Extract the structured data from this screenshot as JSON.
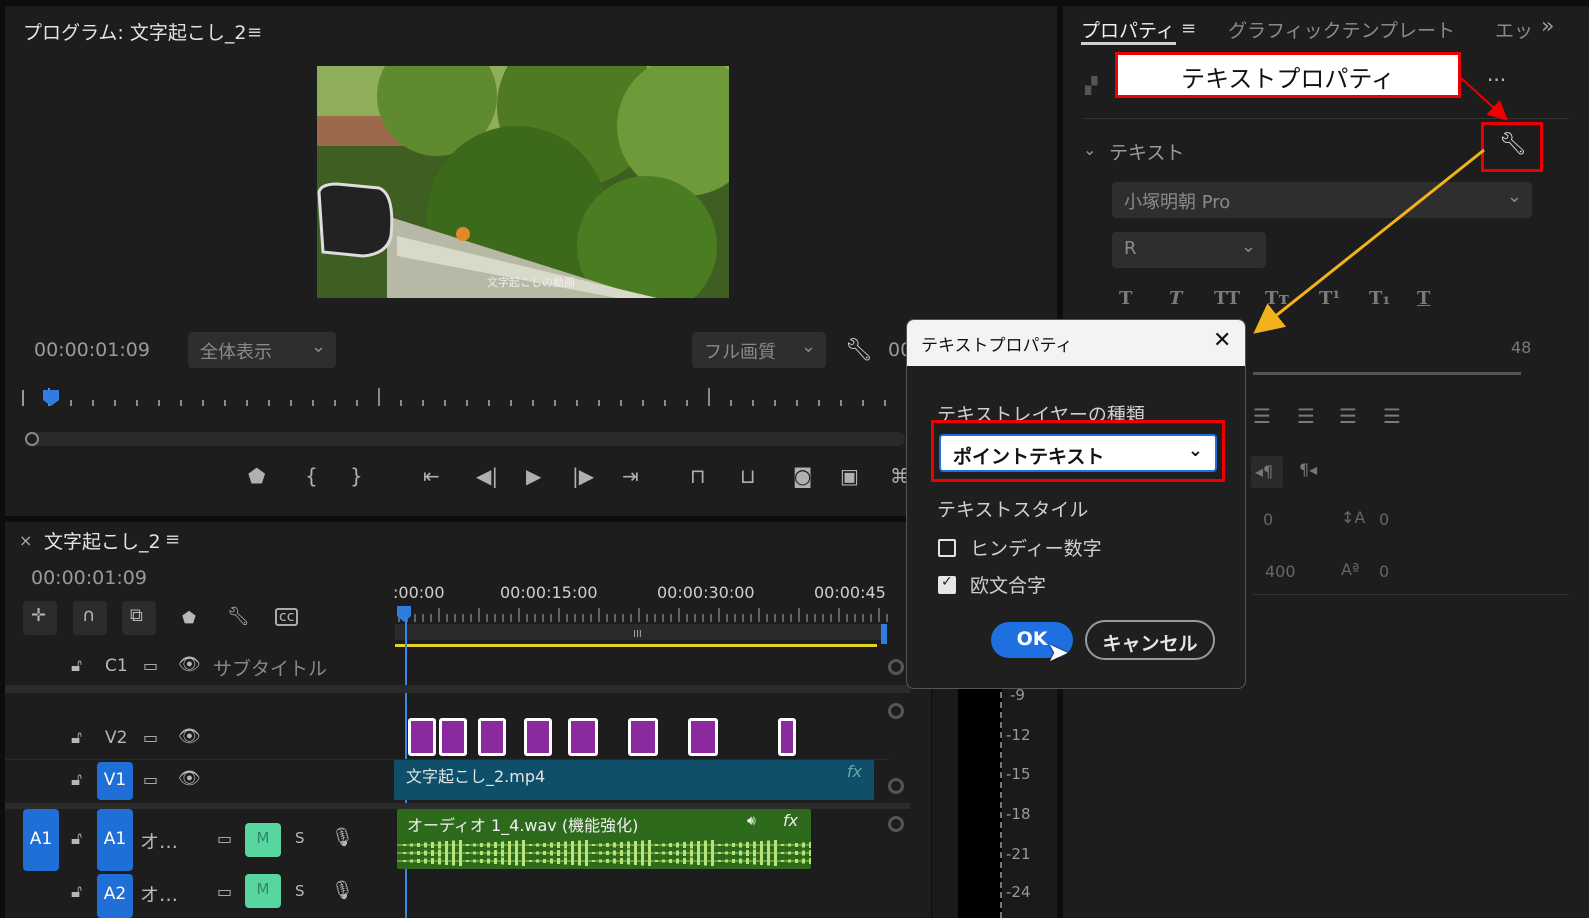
{
  "program": {
    "title": "プログラム: 文字起こし_2",
    "timecode": "00:00:01:09",
    "zoom": "全体表示",
    "quality": "フル画質",
    "overlay_caption": "文字起こしの動画",
    "right_partial": "00"
  },
  "timeline": {
    "sequence_title": "文字起こし_2",
    "timecode": "00:00:01:09",
    "ruler": [
      ":00:00",
      "00:00:15:00",
      "00:00:30:00",
      "00:00:45"
    ],
    "tracks": {
      "c1": "C1",
      "subtitle": "サブタイトル",
      "v2": "V2",
      "v1": "V1",
      "a1_src": "A1",
      "a1": "A1",
      "a1_name": "オ…",
      "a2": "A2",
      "a2_name": "オ…",
      "m": "M",
      "s": "S"
    },
    "video_clip": "文字起こし_2.mp4",
    "audio_clip": "オーディオ 1_4.wav (機能強化)",
    "fx": "fx"
  },
  "meters": {
    "ticks": [
      "-9",
      "-12",
      "-15",
      "-18",
      "-21",
      "-24"
    ]
  },
  "properties": {
    "tab_active": "プロパティ",
    "tab_graphics": "グラフィックテンプレート",
    "tab_partial": "エッ",
    "section_text": "テキスト",
    "font": "小塚明朝 Pro",
    "weight": "R",
    "font_size": "48",
    "tracking": "0",
    "leading": "0",
    "kerning": "400",
    "baseline": "0"
  },
  "callout": {
    "label": "テキストプロパティ"
  },
  "dialog": {
    "title": "テキストプロパティ",
    "layer_type_label": "テキストレイヤーの種類",
    "layer_type_value": "ポイントテキスト",
    "style_label": "テキストスタイル",
    "hindi_label": "ヒンディー数字",
    "hindi_checked": false,
    "ligature_label": "欧文合字",
    "ligature_checked": true,
    "ok": "OK",
    "cancel": "キャンセル"
  }
}
